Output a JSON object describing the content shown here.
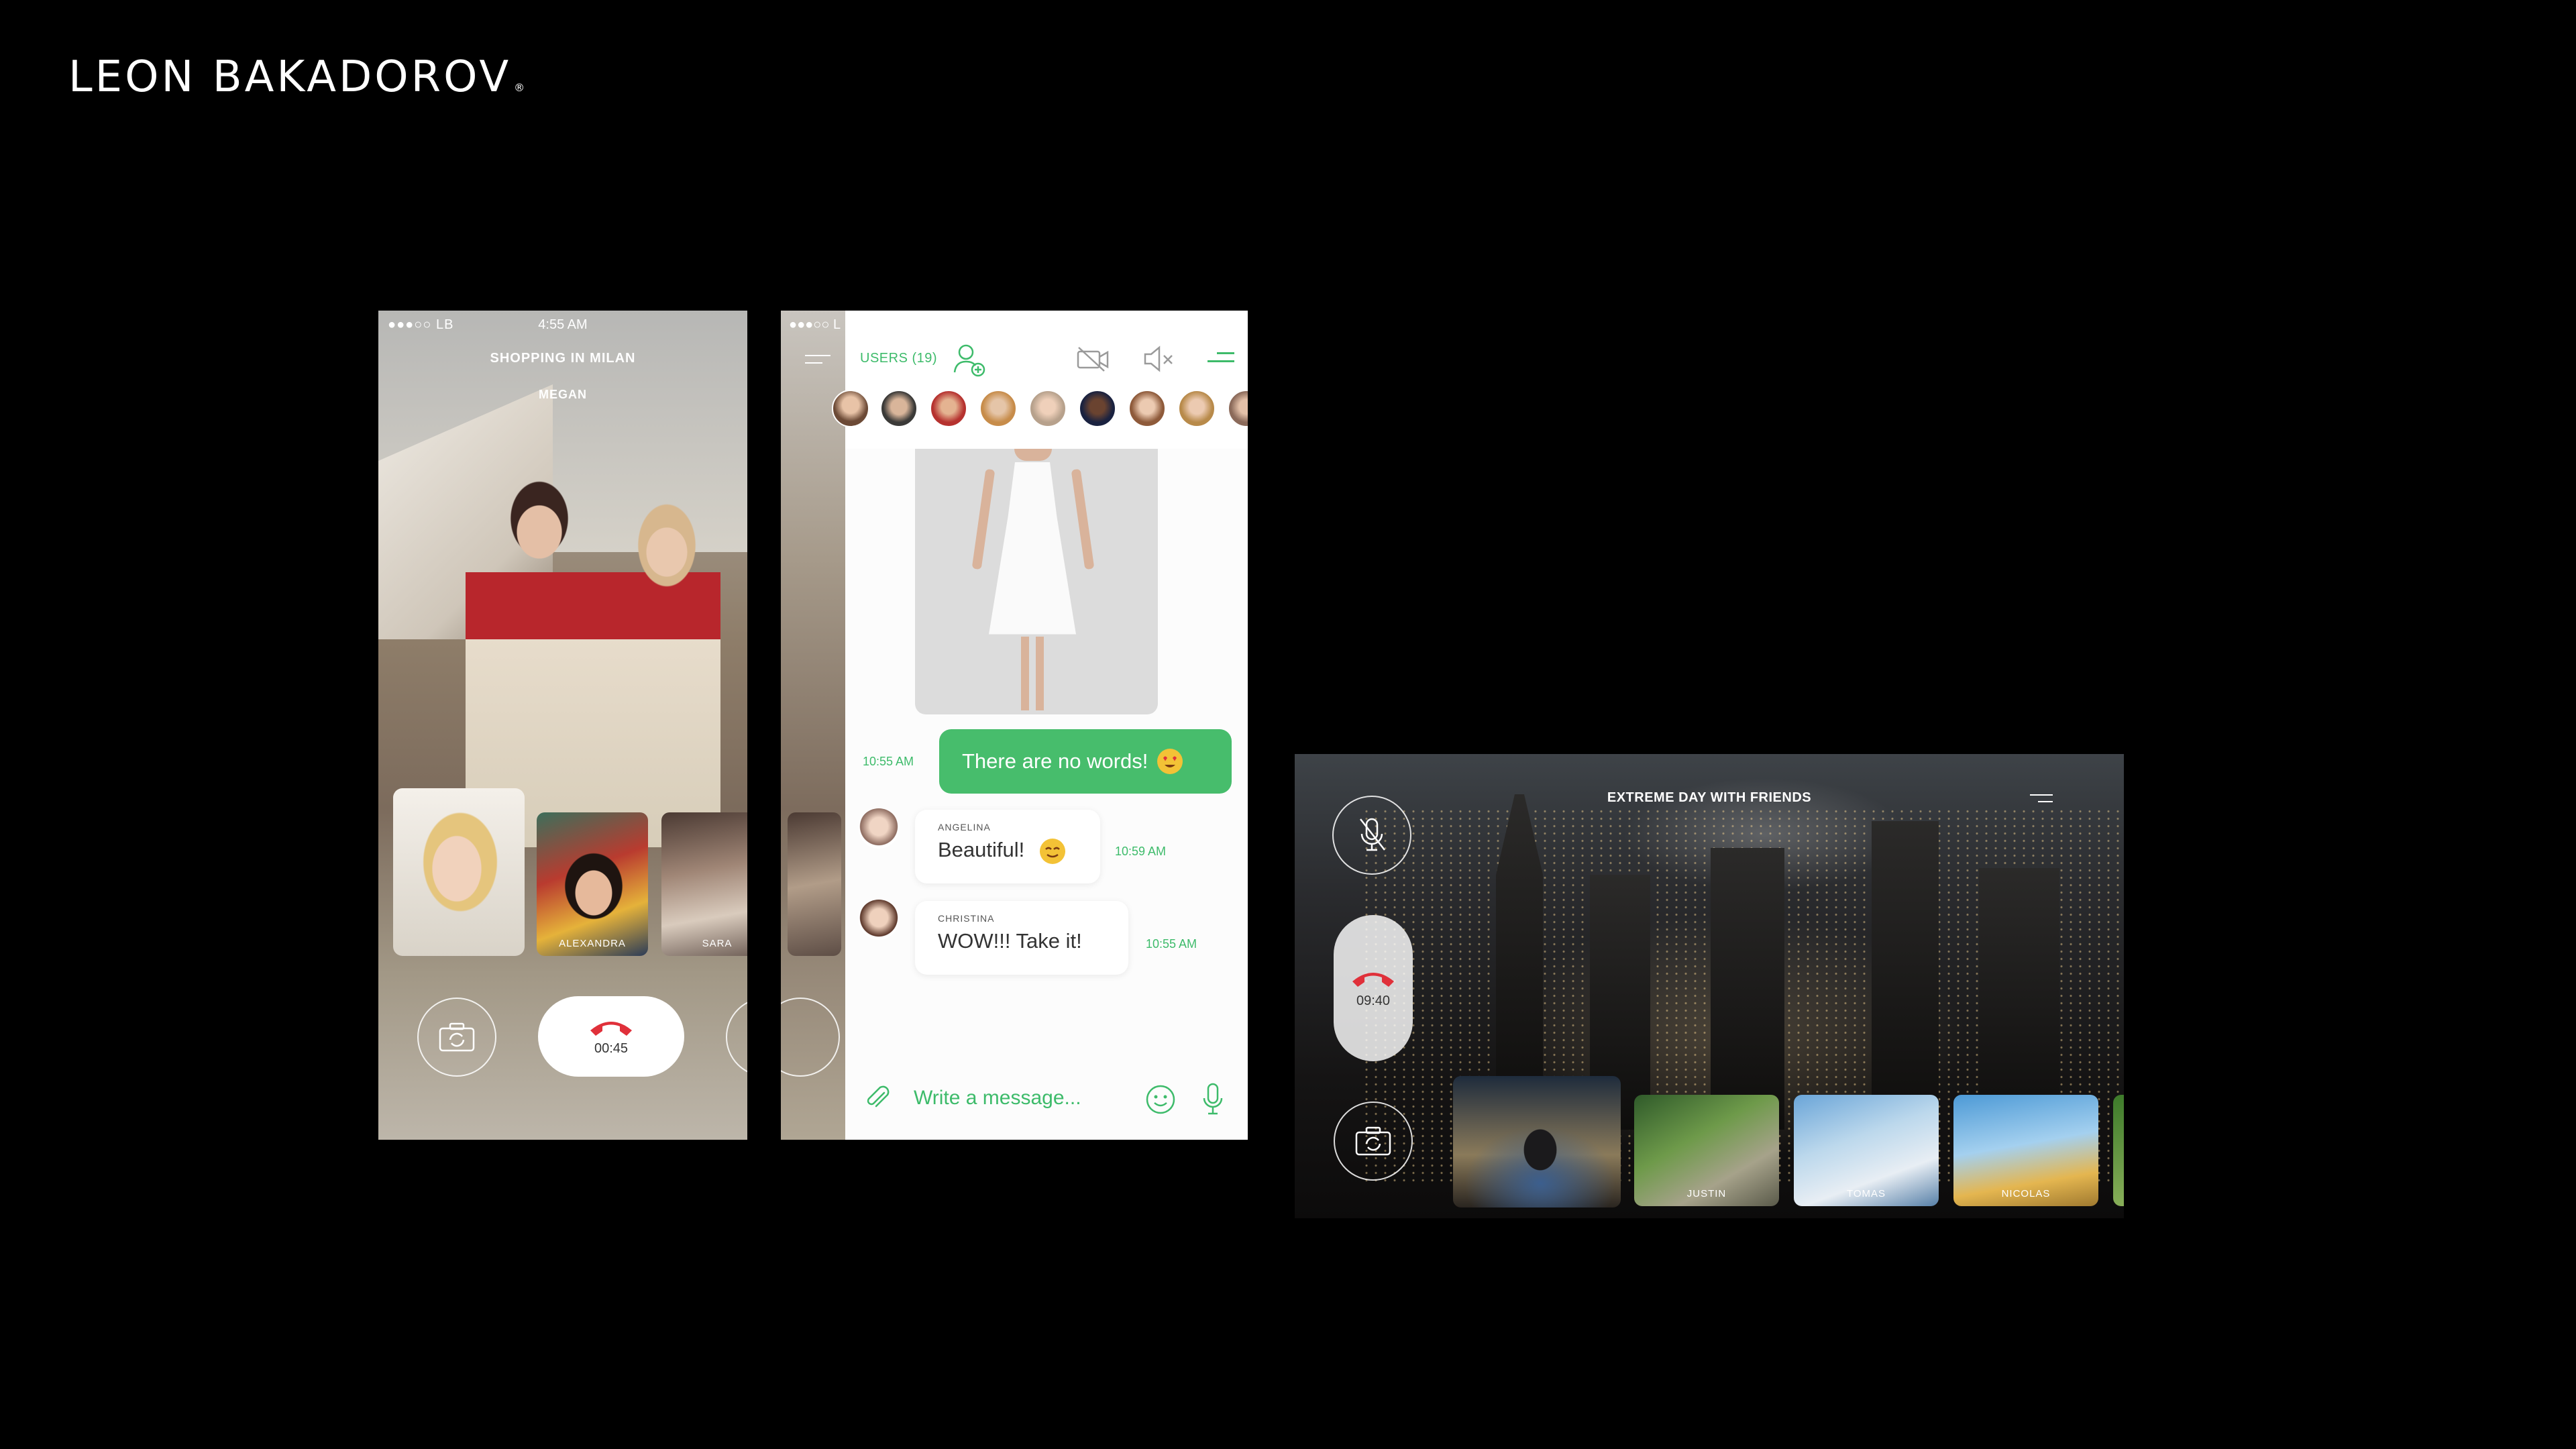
{
  "brand": {
    "name": "LEON BAKADOROV",
    "mark": "®"
  },
  "phone_call": {
    "status_signal": "●●●○○ LB",
    "status_time": "4:55 AM",
    "room_title": "SHOPPING IN MILAN",
    "caller_name": "MEGAN",
    "participants": [
      {
        "name": "ALEXANDRA"
      },
      {
        "name": "SARA"
      }
    ],
    "call_timer": "00:45"
  },
  "phone_chat": {
    "behind_signal": "●●●○○ L",
    "users_label": "USERS (19)",
    "messages": {
      "outgoing": {
        "time": "10:55 AM",
        "text": "There are no words!"
      },
      "incoming": [
        {
          "sender": "ANGELINA",
          "text": "Beautiful!",
          "time": "10:59 AM"
        },
        {
          "sender": "CHRISTINA",
          "text": "WOW!!! Take it!",
          "time": "10:55 AM"
        }
      ]
    },
    "composer_placeholder": "Write a message..."
  },
  "tablet_call": {
    "room_title": "EXTREME DAY WITH FRIENDS",
    "call_timer": "09:40",
    "participants": [
      {
        "name": "JUSTIN"
      },
      {
        "name": "TOMAS"
      },
      {
        "name": "NICOLAS"
      }
    ]
  },
  "colors": {
    "background": "#000000",
    "accent_green": "#3dbb6a",
    "hangup_red": "#e0303a"
  }
}
